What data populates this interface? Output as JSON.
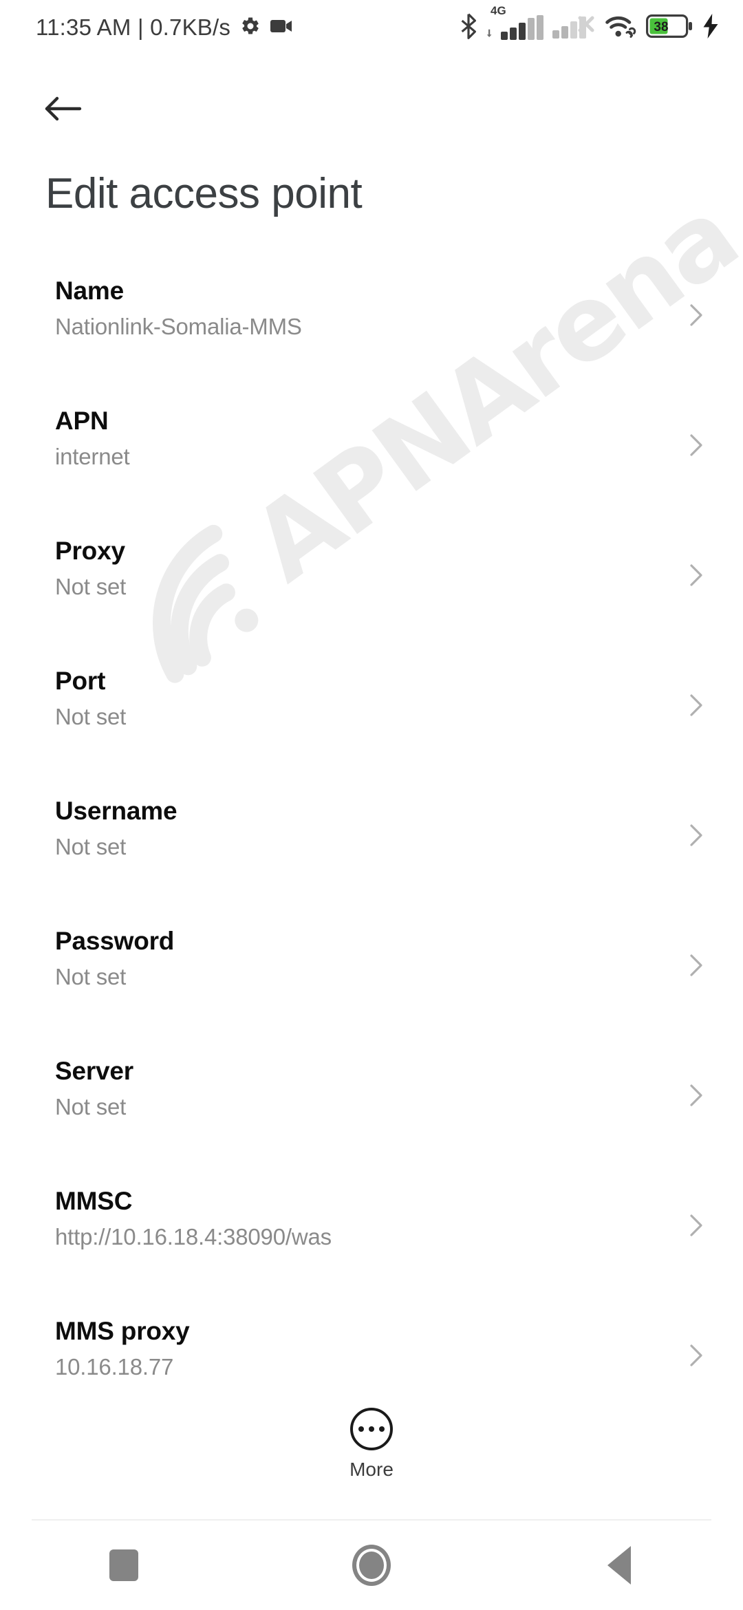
{
  "status_bar": {
    "clock": "11:35 AM | 0.7KB/s",
    "icons": {
      "settings": "gear-icon",
      "screen_record": "video-camera-icon",
      "bluetooth": "bluetooth-icon",
      "signal_sim1": "signal-bars-icon",
      "network_type": "4G",
      "signal_sim2": "signal-bars-no-service-icon",
      "wifi": "wifi-link-icon",
      "battery": "battery-icon",
      "charging": "charging-bolt-icon"
    },
    "battery_level": "38"
  },
  "header": {
    "back_icon": "arrow-left-icon",
    "title": "Edit access point"
  },
  "list": {
    "chevron_icon": "chevron-right-icon",
    "rows": [
      {
        "title": "Name",
        "value": "Nationlink-Somalia-MMS"
      },
      {
        "title": "APN",
        "value": "internet"
      },
      {
        "title": "Proxy",
        "value": "Not set"
      },
      {
        "title": "Port",
        "value": "Not set"
      },
      {
        "title": "Username",
        "value": "Not set"
      },
      {
        "title": "Password",
        "value": "Not set"
      },
      {
        "title": "Server",
        "value": "Not set"
      },
      {
        "title": "MMSC",
        "value": "http://10.16.18.4:38090/was"
      },
      {
        "title": "MMS proxy",
        "value": "10.16.18.77"
      }
    ]
  },
  "more_button": {
    "icon": "more-horizontal-circle-icon",
    "label": "More"
  },
  "nav_bar": {
    "recents": "square-recents-icon",
    "home": "circle-home-icon",
    "back": "triangle-back-icon"
  },
  "watermark": {
    "text": "APNArena",
    "icon": "wifi-arc-icon",
    "color": "#ececec"
  },
  "colors": {
    "background": "#ffffff",
    "title_text": "#3c4043",
    "row_title": "#0d0d0d",
    "row_value": "#8a8a8a",
    "chevron": "#b0b0b0",
    "nav_icon": "#848484",
    "battery_fill": "#4ac13c",
    "status_text": "#3c3c3c"
  }
}
